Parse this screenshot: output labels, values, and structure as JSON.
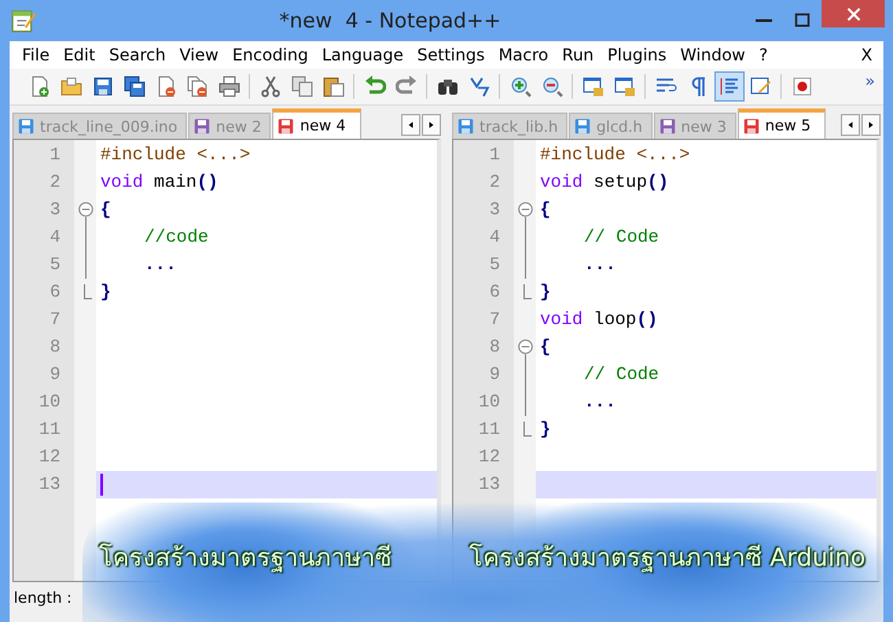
{
  "window": {
    "title": "*new  4 - Notepad++"
  },
  "menu": {
    "items": [
      "File",
      "Edit",
      "Search",
      "View",
      "Encoding",
      "Language",
      "Settings",
      "Macro",
      "Run",
      "Plugins",
      "Window",
      "?"
    ],
    "close": "X"
  },
  "toolbar": {
    "buttons": [
      {
        "pressed": false
      },
      {
        "pressed": false
      },
      {
        "pressed": false
      },
      {
        "pressed": false
      },
      {
        "pressed": false
      },
      {
        "pressed": false
      },
      {
        "pressed": false
      },
      {
        "pressed": false
      },
      {
        "pressed": false
      },
      {
        "pressed": false
      },
      {
        "pressed": false
      },
      {
        "pressed": false
      },
      {
        "pressed": false
      },
      {
        "pressed": false
      },
      {
        "pressed": false
      },
      {
        "pressed": false
      },
      {
        "pressed": false
      },
      {
        "pressed": false
      },
      {
        "pressed": false
      },
      {
        "pressed": false
      },
      {
        "pressed": true
      },
      {
        "pressed": false
      },
      {
        "pressed": false
      }
    ],
    "overflow": "»"
  },
  "panes": [
    {
      "tabs": [
        {
          "label": "track_line_009.ino",
          "selected": false,
          "color": "#3a8ee0"
        },
        {
          "label": "new 2",
          "selected": false,
          "color": "#8a5fb0"
        },
        {
          "label": "new 4",
          "selected": true,
          "color": "#e03a3a"
        }
      ],
      "lines": [
        {
          "number": "1",
          "kind": "plain",
          "current": false,
          "tokens": [
            {
              "text": "#include <...>",
              "kind": "preproc"
            }
          ]
        },
        {
          "number": "2",
          "kind": "plain",
          "current": false,
          "tokens": [
            {
              "text": "void",
              "kind": "keyword"
            },
            {
              "text": " main",
              "kind": "plain"
            },
            {
              "text": "()",
              "kind": "operator"
            }
          ]
        },
        {
          "number": "3",
          "kind": "fold_start",
          "current": false,
          "tokens": [
            {
              "text": "{",
              "kind": "operator"
            }
          ]
        },
        {
          "number": "4",
          "kind": "fold_body",
          "current": false,
          "tokens": [
            {
              "text": "//code",
              "kind": "comment"
            }
          ]
        },
        {
          "number": "5",
          "kind": "fold_body",
          "current": false,
          "tokens": [
            {
              "text": "...",
              "kind": "operator"
            }
          ]
        },
        {
          "number": "6",
          "kind": "fold_end",
          "current": false,
          "tokens": [
            {
              "text": "}",
              "kind": "operator"
            }
          ]
        },
        {
          "number": "7",
          "kind": "plain",
          "current": false
        },
        {
          "number": "8",
          "kind": "plain",
          "current": false
        },
        {
          "number": "9",
          "kind": "plain",
          "current": false
        },
        {
          "number": "10",
          "kind": "plain",
          "current": false
        },
        {
          "number": "11",
          "kind": "plain",
          "current": false
        },
        {
          "number": "12",
          "kind": "plain",
          "current": false
        },
        {
          "number": "13",
          "kind": "plain",
          "current": true
        }
      ],
      "caret": true
    },
    {
      "tabs": [
        {
          "label": "track_lib.h",
          "selected": false,
          "color": "#3a8ee0"
        },
        {
          "label": "glcd.h",
          "selected": false,
          "color": "#3a8ee0"
        },
        {
          "label": "new 3",
          "selected": false,
          "color": "#8a5fb0"
        },
        {
          "label": "new 5",
          "selected": true,
          "color": "#e03a3a"
        }
      ],
      "lines": [
        {
          "number": "1",
          "kind": "plain",
          "current": false,
          "tokens": [
            {
              "text": "#include <...>",
              "kind": "preproc"
            }
          ]
        },
        {
          "number": "2",
          "kind": "plain",
          "current": false,
          "tokens": [
            {
              "text": "void",
              "kind": "keyword"
            },
            {
              "text": " setup",
              "kind": "plain"
            },
            {
              "text": "()",
              "kind": "operator"
            }
          ]
        },
        {
          "number": "3",
          "kind": "fold_start",
          "current": false,
          "tokens": [
            {
              "text": "{",
              "kind": "operator"
            }
          ]
        },
        {
          "number": "4",
          "kind": "fold_body",
          "current": false,
          "tokens": [
            {
              "text": "// Code",
              "kind": "comment"
            }
          ]
        },
        {
          "number": "5",
          "kind": "fold_body",
          "current": false,
          "tokens": [
            {
              "text": "...",
              "kind": "operator"
            }
          ]
        },
        {
          "number": "6",
          "kind": "fold_end",
          "current": false,
          "tokens": [
            {
              "text": "}",
              "kind": "operator"
            }
          ]
        },
        {
          "number": "7",
          "kind": "plain",
          "current": false,
          "tokens": [
            {
              "text": "void",
              "kind": "keyword"
            },
            {
              "text": " loop",
              "kind": "plain"
            },
            {
              "text": "()",
              "kind": "operator"
            }
          ]
        },
        {
          "number": "8",
          "kind": "fold_start",
          "current": false,
          "tokens": [
            {
              "text": "{",
              "kind": "operator"
            }
          ]
        },
        {
          "number": "9",
          "kind": "fold_body",
          "current": false,
          "tokens": [
            {
              "text": "// Code",
              "kind": "comment"
            }
          ]
        },
        {
          "number": "10",
          "kind": "fold_body",
          "current": false,
          "tokens": [
            {
              "text": "...",
              "kind": "operator"
            }
          ]
        },
        {
          "number": "11",
          "kind": "fold_end",
          "current": false,
          "tokens": [
            {
              "text": "}",
              "kind": "operator"
            }
          ]
        },
        {
          "number": "12",
          "kind": "plain",
          "current": false
        },
        {
          "number": "13",
          "kind": "plain",
          "current": true
        }
      ],
      "caret": false
    }
  ],
  "status_bar": {
    "text": "length :"
  },
  "overlay": {
    "captions": [
      "โครงสร้างมาตรฐานภาษาซี",
      "โครงสร้างมาตรฐานภาษาซี Arduino"
    ]
  }
}
